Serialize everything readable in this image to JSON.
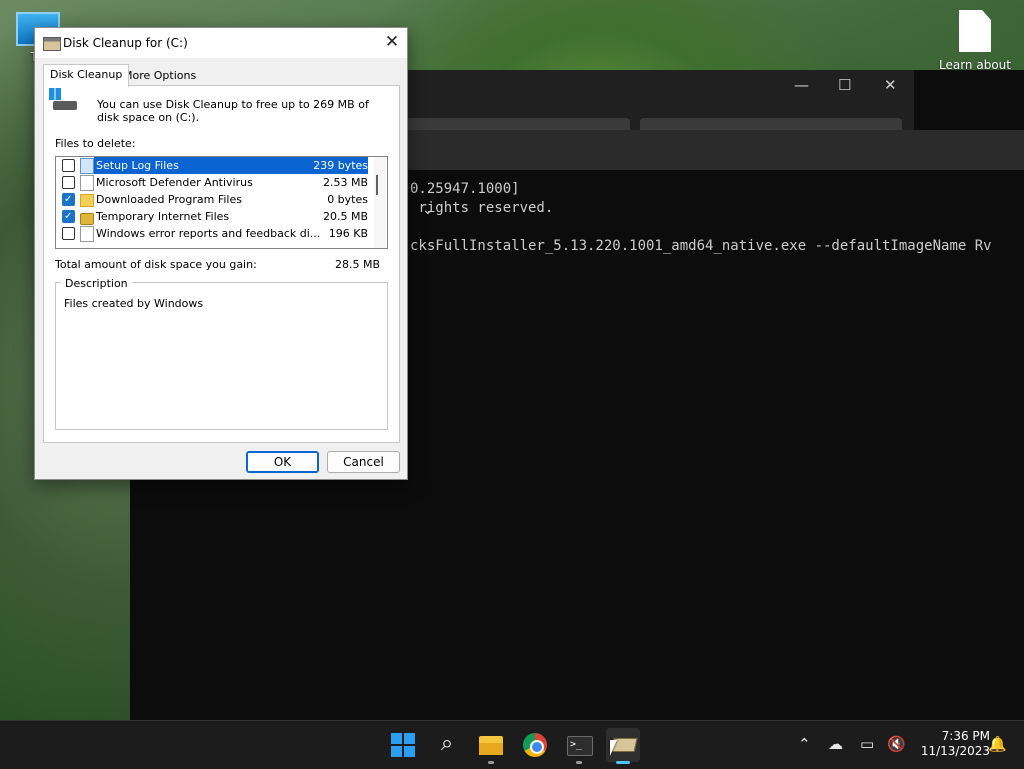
{
  "desktop": {
    "this_pc_label": "Th",
    "learn_label": "Learn about this picture"
  },
  "terminal": {
    "lines": [
      "0.25947.1000]",
      " rights reserved.",
      "cksFullInstaller_5.13.220.1001_amd64_native.exe --defaultImageName Rv"
    ],
    "chevron": "⌄"
  },
  "dialog": {
    "title": "Disk Cleanup for  (C:)",
    "close": "✕",
    "tabs": [
      {
        "label": "Disk Cleanup",
        "active": true
      },
      {
        "label": "More Options",
        "active": false
      }
    ],
    "intro": "You can use Disk Cleanup to free up to 269 MB of disk space on  (C:).",
    "files_label": "Files to delete:",
    "files": [
      {
        "name": "Setup Log Files",
        "size": "239 bytes",
        "checked": false,
        "selected": true,
        "icon": "doc-blue"
      },
      {
        "name": "Microsoft Defender Antivirus",
        "size": "2.53 MB",
        "checked": false,
        "selected": false,
        "icon": "doc"
      },
      {
        "name": "Downloaded Program Files",
        "size": "0 bytes",
        "checked": true,
        "selected": false,
        "icon": "folder"
      },
      {
        "name": "Temporary Internet Files",
        "size": "20.5 MB",
        "checked": true,
        "selected": false,
        "icon": "lock"
      },
      {
        "name": "Windows error reports and feedback di...",
        "size": "196 KB",
        "checked": false,
        "selected": false,
        "icon": "doc"
      }
    ],
    "total_label": "Total amount of disk space you gain:",
    "total_value": "28.5 MB",
    "description_label": "Description",
    "description_text": "Files created by Windows",
    "ok_label": "OK",
    "cancel_label": "Cancel"
  },
  "taskbar": {
    "apps": [
      "start-icon",
      "search-icon",
      "file-explorer-icon",
      "chrome-icon",
      "terminal-icon",
      "disk-cleanup-icon"
    ],
    "terminal_glyph": ">_",
    "tray": {
      "chevron": "⌃",
      "time": "7:36 PM",
      "date": "11/13/2023"
    }
  },
  "colors": {
    "selection": "#0a64d2",
    "checkbox_checked": "#1a73c9",
    "taskbar": "#1c1c1c",
    "terminal_bg": "#0c0c0c"
  }
}
